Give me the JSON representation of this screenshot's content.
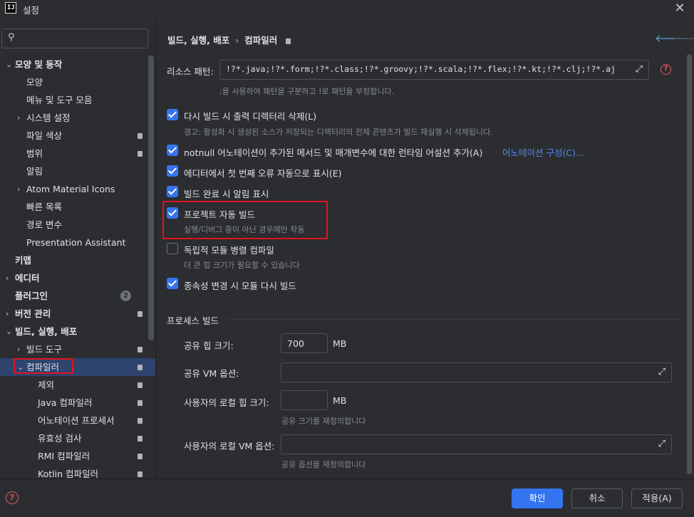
{
  "window": {
    "title": "설정",
    "logo": "IJ"
  },
  "sidebar": {
    "search_placeholder": "",
    "items": [
      {
        "label": "모양 및 동작",
        "bold": true,
        "chevron": "⌄",
        "level": 0
      },
      {
        "label": "모양",
        "level": 1
      },
      {
        "label": "메뉴 및 도구 모음",
        "level": 1
      },
      {
        "label": "시스템 설정",
        "chevron": "›",
        "level": 1
      },
      {
        "label": "파일 색상",
        "level": 1,
        "badge": true
      },
      {
        "label": "범위",
        "level": 1,
        "badge": true
      },
      {
        "label": "알림",
        "level": 1
      },
      {
        "label": "Atom Material Icons",
        "chevron": "›",
        "level": 1
      },
      {
        "label": "빠른 목록",
        "level": 1
      },
      {
        "label": "경로 변수",
        "level": 1
      },
      {
        "label": "Presentation Assistant",
        "level": 1
      },
      {
        "label": "키맵",
        "bold": true,
        "level": 0
      },
      {
        "label": "에디터",
        "bold": true,
        "chevron": "›",
        "level": 0
      },
      {
        "label": "플러그인",
        "bold": true,
        "level": 0,
        "help_badge": "2"
      },
      {
        "label": "버전 관리",
        "bold": true,
        "chevron": "›",
        "level": 0,
        "badge": true
      },
      {
        "label": "빌드, 실행, 배포",
        "bold": true,
        "chevron": "⌄",
        "level": 0
      },
      {
        "label": "빌드 도구",
        "chevron": "›",
        "level": 1,
        "badge": true
      },
      {
        "label": "컴파일러",
        "chevron": "⌄",
        "level": 1,
        "badge": true,
        "selected": true
      },
      {
        "label": "제외",
        "level": 2,
        "badge": true
      },
      {
        "label": "Java 컴파일러",
        "level": 2,
        "badge": true
      },
      {
        "label": "어노테이션 프로세서",
        "level": 2,
        "badge": true
      },
      {
        "label": "유효성 검사",
        "level": 2,
        "badge": true
      },
      {
        "label": "RMI 컴파일러",
        "level": 2,
        "badge": true
      },
      {
        "label": "Kotlin 컴파일러",
        "level": 2,
        "badge": true
      }
    ]
  },
  "main": {
    "breadcrumb": {
      "parent": "빌드, 실행, 배포",
      "separator": "›",
      "current": "컴파일러"
    },
    "nav": {
      "back": "🡐",
      "forward": "🡒"
    },
    "resource_patterns": {
      "label": "리소스 패턴:",
      "value": "!?*.java;!?*.form;!?*.class;!?*.groovy;!?*.scala;!?*.flex;!?*.kt;!?*.clj;!?*.aj",
      "hint": ";을 사용하여 패턴을 구분하고 !로 패턴을 부정합니다."
    },
    "options": {
      "clear_output": {
        "label": "다시 빌드 시 출력 디렉터리 삭제(L)",
        "checked": true,
        "hint": "경고: 활성화 시 생성된 소스가 저장되는 디렉터리의 전체 콘텐츠가 빌드 재실행 시 삭제됩니다."
      },
      "notnull": {
        "label": "notnull 어노테이션이 추가된 메서드 및 매개변수에 대한 런타임 어설션 추가(A)",
        "checked": true,
        "link": "어노테이션 구성(C)..."
      },
      "first_error": {
        "label": "에디터에서 첫 번째 오류 자동으로 표시(E)",
        "checked": true
      },
      "notify_build": {
        "label": "빌드 완료 시 알림 표시",
        "checked": true
      },
      "auto_build": {
        "label": "프로젝트 자동 빌드",
        "checked": true,
        "hint": "실행/디버그 중이 아닌 경우에만 작동"
      },
      "parallel": {
        "label": "독립적 모듈 병렬 컴파일",
        "checked": false,
        "hint": "더 큰 힙 크기가 필요할 수 있습니다"
      },
      "rebuild_deps": {
        "label": "종속성 변경 시 모듈 다시 빌드",
        "checked": true
      }
    },
    "process_build": {
      "title": "프로세스 빌드",
      "shared_heap": {
        "label": "공유 힙 크기:",
        "value": "700",
        "unit": "MB"
      },
      "shared_vm": {
        "label": "공유 VM 옵션:",
        "value": ""
      },
      "user_heap": {
        "label": "사용자의 로컬 힙 크기:",
        "value": "",
        "unit": "MB",
        "hint": "공유 크기를 재정의합니다"
      },
      "user_vm": {
        "label": "사용자의 로컬 VM 옵션:",
        "value": "",
        "hint": "공유 옵션을 재정의합니다"
      }
    }
  },
  "footer": {
    "ok": "확인",
    "cancel": "취소",
    "apply": "적용(A)",
    "help": "?"
  },
  "colors": {
    "accent": "#3574f0",
    "background": "#2b2d30",
    "highlight": "#e0141e",
    "link": "#548af7"
  }
}
